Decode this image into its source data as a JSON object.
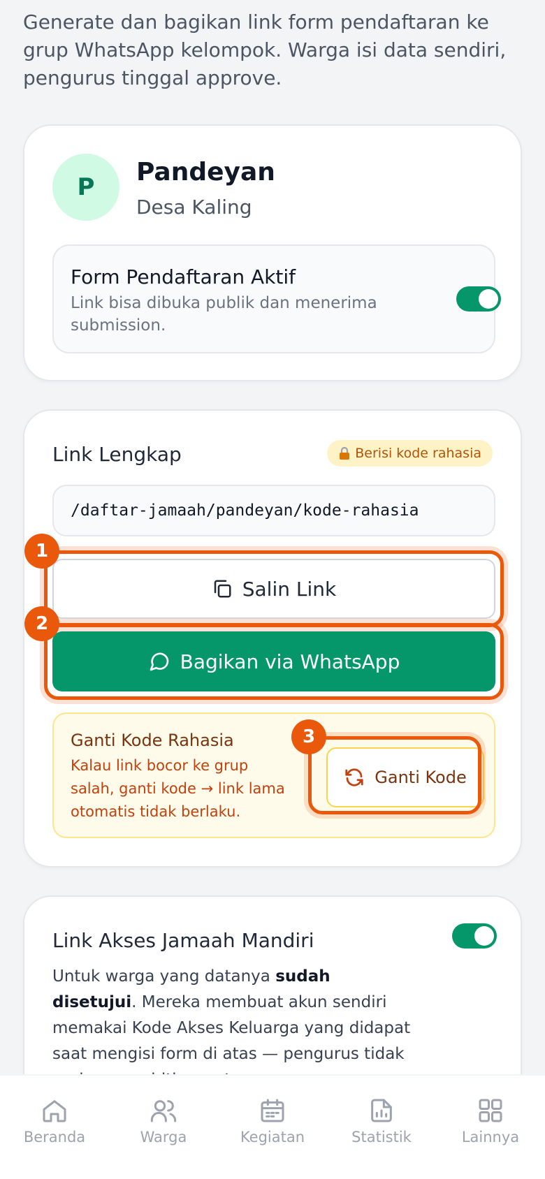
{
  "intro": {
    "text": "Generate dan bagikan link form pendaftaran ke grup WhatsApp kelompok. Warga isi data sendiri, pengurus tinggal approve."
  },
  "group": {
    "avatar_letter": "P",
    "name": "Pandeyan",
    "subtitle": "Desa Kaling",
    "form_toggle": {
      "title": "Form Pendaftaran Aktif",
      "desc": "Link bisa dibuka publik dan menerima submission.",
      "enabled": true
    }
  },
  "link": {
    "title": "Link Lengkap",
    "badge": "Berisi kode rahasia",
    "url": "/daftar-jamaah/pandeyan/kode-rahasia",
    "copy_label": "Salin Link",
    "share_label": "Bagikan via WhatsApp",
    "reset": {
      "title": "Ganti Kode Rahasia",
      "desc": "Kalau link bocor ke grup salah, ganti kode → link lama otomatis tidak berlaku.",
      "button": "Ganti Kode"
    }
  },
  "highlights": [
    "1",
    "2",
    "3"
  ],
  "access": {
    "title": "Link Akses Jamaah Mandiri",
    "enabled": true,
    "text_before": "Untuk warga yang datanya ",
    "text_bold": "sudah disetujui",
    "text_after": ". Mereka membuat akun sendiri memakai Kode Akses Keluarga yang didapat saat mengisi form di atas — pengurus tidak perlu menerbitkan satu"
  },
  "nav": [
    {
      "label": "Beranda",
      "icon": "home-icon"
    },
    {
      "label": "Warga",
      "icon": "users-icon"
    },
    {
      "label": "Kegiatan",
      "icon": "calendar-icon"
    },
    {
      "label": "Statistik",
      "icon": "chart-icon"
    },
    {
      "label": "Lainnya",
      "icon": "grid-icon"
    }
  ],
  "colors": {
    "primary": "#059669",
    "highlight": "#ea580c",
    "warning_bg": "#fffbeb"
  }
}
